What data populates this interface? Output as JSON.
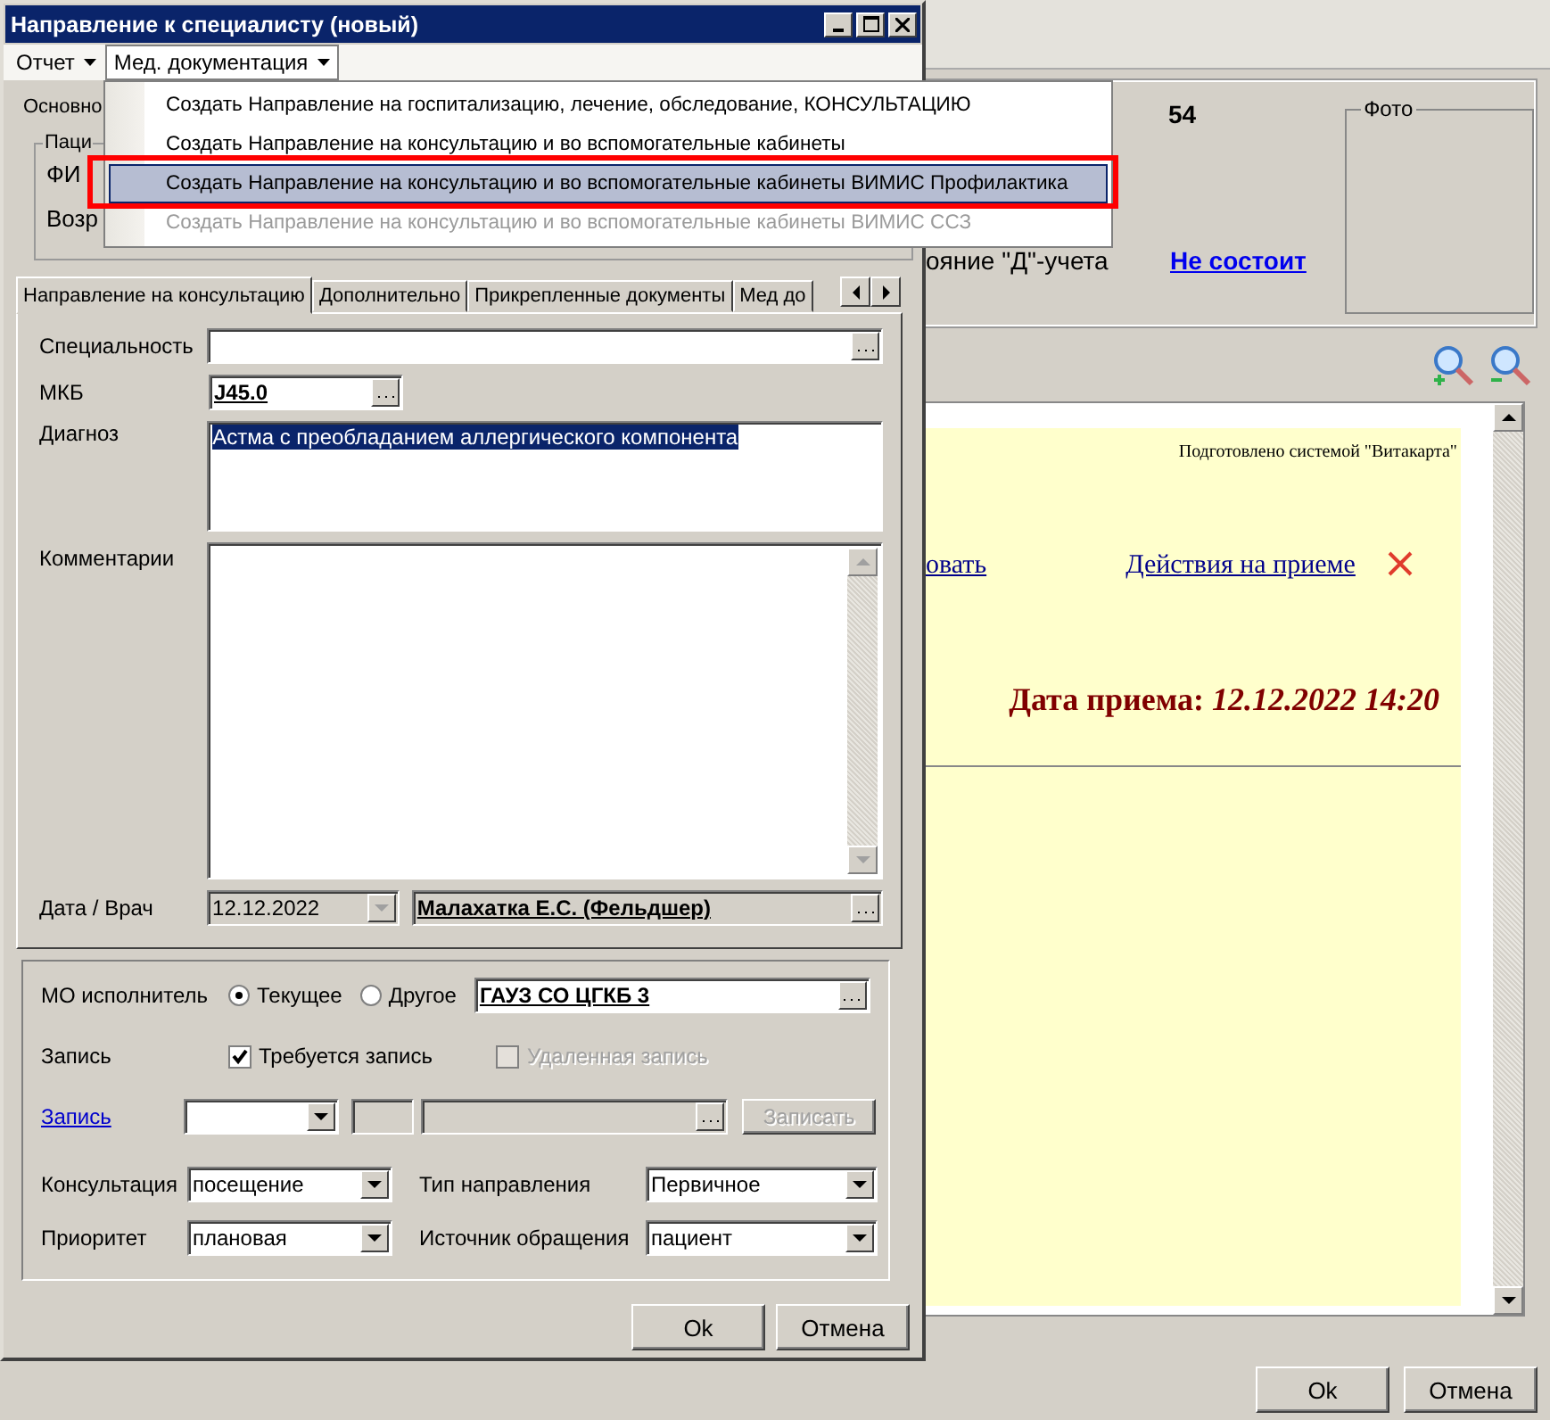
{
  "background": {
    "age_value": "54",
    "d_status_label": "ояние \"Д\"-учета",
    "d_status_link": "Не состоит",
    "photo_label": "Фото",
    "document": {
      "caption": "Подготовлено системой \"Витакарта\"",
      "link_fragment": "овать",
      "actions_link": "Действия на приеме",
      "date": "Дата приема: *12.12.2022 14:20*"
    },
    "buttons": [
      "Ok",
      "Отмена"
    ]
  },
  "dialog": {
    "title": "Направление к специалисту (новый)",
    "menu": [
      {
        "label": "Отчет",
        "selected": false
      },
      {
        "label": "Мед. документация",
        "selected": true
      }
    ],
    "dropdown": [
      {
        "label": "Создать Направление на госпитализацию, лечение, обследование, КОНСУЛЬТАЦИЮ",
        "selected": false,
        "disabled": false,
        "highlighted": false
      },
      {
        "label": "Создать Направление на консультацию и во вспомогательные кабинеты",
        "selected": false,
        "disabled": false,
        "highlighted": false
      },
      {
        "label": "Создать Направление на консультацию и во вспомогательные кабинеты ВИМИС Профилактика",
        "selected": true,
        "disabled": false,
        "highlighted": true
      },
      {
        "label": "Создать Направление на консультацию и во вспомогательные кабинеты ВИМИС ССЗ",
        "selected": false,
        "disabled": true,
        "highlighted": false
      }
    ],
    "hidden_page": {
      "tab": "Основно",
      "group": "Паци",
      "fio_label": "ФИ",
      "age_label": "Возр"
    },
    "tabs": [
      {
        "label": "Направление на консультацию",
        "selected": true
      },
      {
        "label": "Дополнительно",
        "selected": false
      },
      {
        "label": "Прикрепленные документы",
        "selected": false
      },
      {
        "label": "Мед до",
        "selected": false
      }
    ],
    "specialty": {
      "label": "Специальность"
    },
    "mkb": {
      "label": "МКБ",
      "value": "J45.0"
    },
    "diagnosis": {
      "label": "Диагноз",
      "value": "Астма с преобладанием аллергического компонента"
    },
    "comments": {
      "label": "Комментарии"
    },
    "date_doctor": {
      "label": "Дата / Врач",
      "date": "12.12.2022",
      "doctor": "Малахатка Е.С. (Фельдшер)"
    },
    "executor": {
      "label": "МО исполнитель",
      "options": [
        {
          "label": "Текущее",
          "selected": true
        },
        {
          "label": "Другое",
          "selected": false
        }
      ],
      "value": "ГАУЗ СО ЦГКБ 3"
    },
    "booking": {
      "label": "Запись",
      "checks": [
        {
          "label": "Требуется запись",
          "checked": true,
          "disabled": false
        },
        {
          "label": "Удаленная запись",
          "checked": false,
          "disabled": true
        }
      ]
    },
    "booking_row": {
      "link": "Запись",
      "button": "Записать",
      "button_disabled": true
    },
    "selects": [
      {
        "label": "Консультация",
        "value": "посещение"
      },
      {
        "label": "Тип направления",
        "value": "Первичное"
      },
      {
        "label": "Приоритет",
        "value": "плановая"
      },
      {
        "label": "Источник обращения",
        "value": "пациент"
      }
    ],
    "buttons": [
      "Ok",
      "Отмена"
    ]
  }
}
